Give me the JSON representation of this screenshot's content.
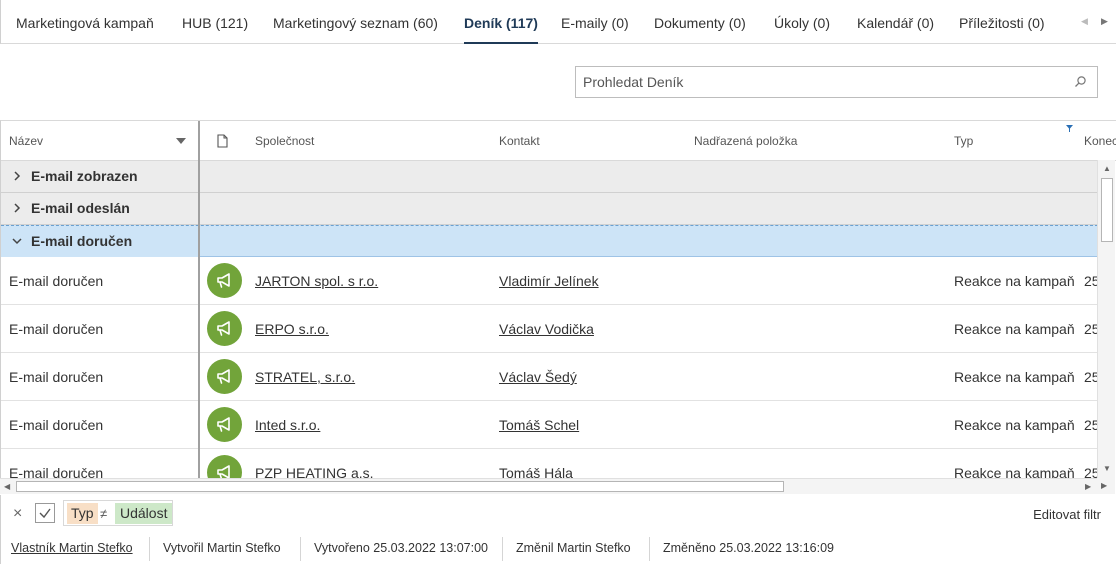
{
  "tabs": [
    {
      "label": "Marketingová kampaň",
      "active": false
    },
    {
      "label": "HUB (121)",
      "active": false
    },
    {
      "label": "Marketingový seznam (60)",
      "active": false
    },
    {
      "label": "Deník (117)",
      "active": true
    },
    {
      "label": "E-maily (0)",
      "active": false
    },
    {
      "label": "Dokumenty (0)",
      "active": false
    },
    {
      "label": "Úkoly (0)",
      "active": false
    },
    {
      "label": "Kalendář (0)",
      "active": false
    },
    {
      "label": "Příležitosti (0)",
      "active": false
    }
  ],
  "search": {
    "placeholder": "Prohledat Deník"
  },
  "columns": {
    "name": "Název",
    "company": "Společnost",
    "contact": "Kontakt",
    "parent": "Nadřazená položka",
    "type": "Typ",
    "end": "Konec"
  },
  "groups": [
    {
      "label": "E-mail zobrazen",
      "expanded": false
    },
    {
      "label": "E-mail odeslán",
      "expanded": false
    },
    {
      "label": "E-mail doručen",
      "expanded": true
    }
  ],
  "rows": [
    {
      "name": "E-mail doručen",
      "company": "JARTON spol. s r.o.",
      "contact": "Vladimír Jelínek",
      "type": "Reakce na kampaň",
      "end": "25"
    },
    {
      "name": "E-mail doručen",
      "company": "ERPO s.r.o.",
      "contact": "Václav Vodička",
      "type": "Reakce na kampaň",
      "end": "25"
    },
    {
      "name": "E-mail doručen",
      "company": "STRATEL, s.r.o.",
      "contact": "Václav Šedý",
      "type": "Reakce na kampaň",
      "end": "25"
    },
    {
      "name": "E-mail doručen",
      "company": "Inted s.r.o.",
      "contact": "Tomáš Schel",
      "type": "Reakce na kampaň",
      "end": "25"
    },
    {
      "name": "E-mail doručen",
      "company": "PZP HEATING a.s.",
      "contact": "Tomáš Hála",
      "type": "Reakce na kampaň",
      "end": "25"
    }
  ],
  "filter": {
    "close": "×",
    "field": "Typ",
    "operator": "≠",
    "value": "Událost",
    "edit": "Editovat filtr"
  },
  "status": {
    "owner": "Vlastník Martin Stefko",
    "created_by": "Vytvořil Martin Stefko",
    "created": "Vytvořeno 25.03.2022 13:07:00",
    "changed_by": "Změnil Martin Stefko",
    "changed": "Změněno 25.03.2022 13:16:09"
  },
  "colors": {
    "accent": "#1f3a57",
    "badge": "#72a43a",
    "selected_group": "#cde4f7",
    "filter_field": "#f8dfc6",
    "filter_value": "#cde8c8"
  },
  "icons": {
    "row_icon": "megaphone-icon",
    "document_column": "document-icon",
    "search": "search-icon"
  }
}
